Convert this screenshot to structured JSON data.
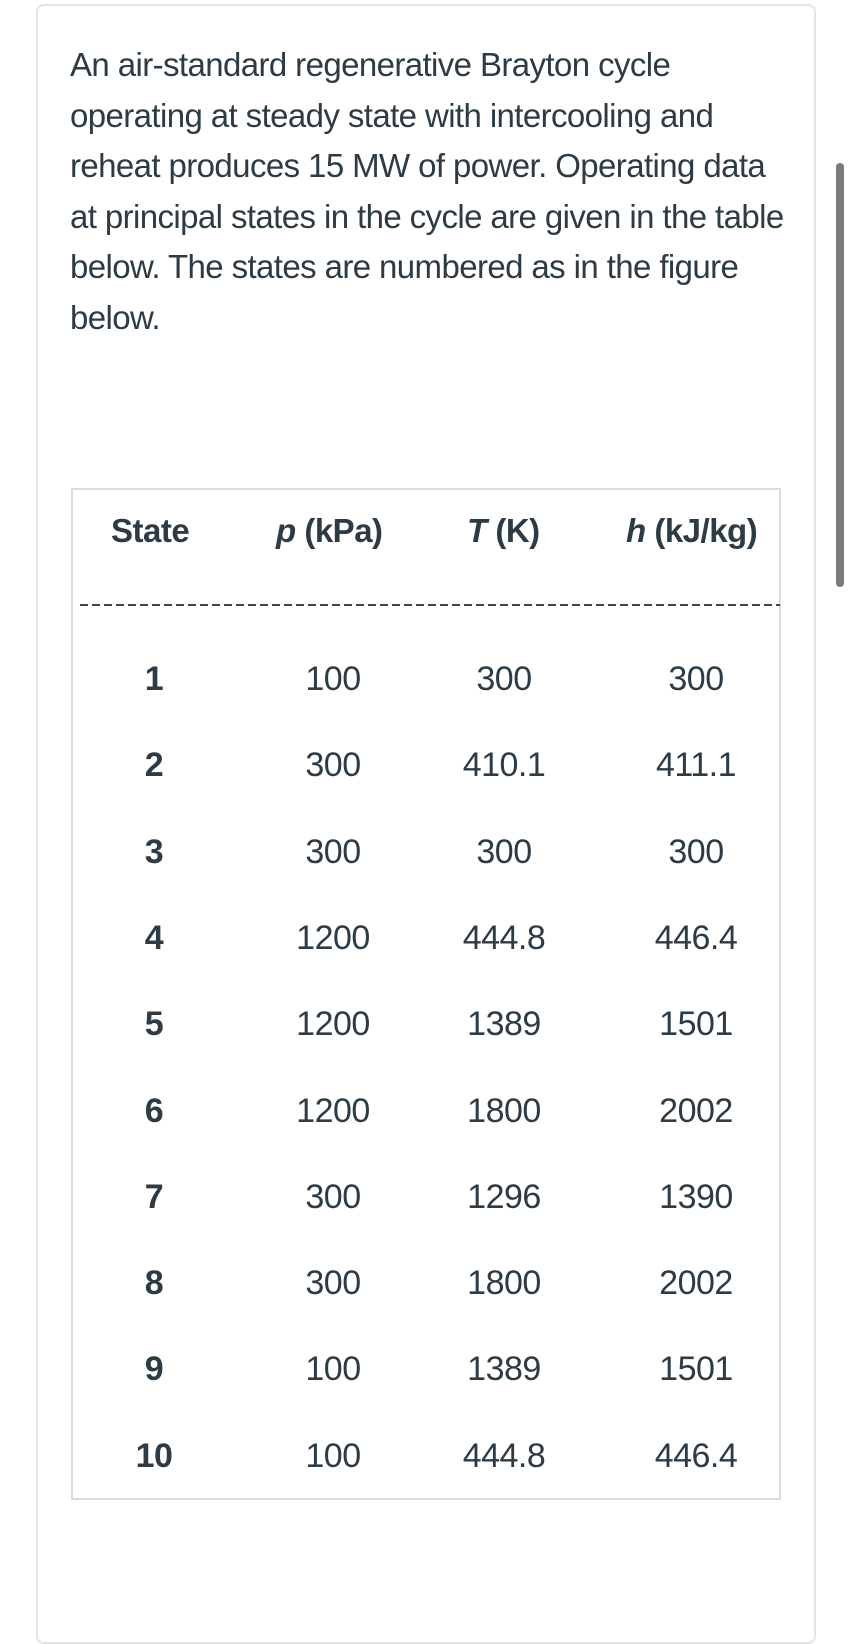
{
  "question": {
    "text": "An air-standard regenerative Brayton cycle operating at steady state with intercooling and reheat produces 15 MW of power. Operating data at principal states in the cycle are given in the table below. The states are numbered as in the figure below."
  },
  "table": {
    "headers": {
      "state": "State",
      "p_sym": "p",
      "p_unit": " (kPa)",
      "T_sym": "T",
      "T_unit": " (K)",
      "h_sym": "h",
      "h_unit": " (kJ/kg)"
    },
    "rows": [
      {
        "state": "1",
        "p": "100",
        "T": "300",
        "h": "300"
      },
      {
        "state": "2",
        "p": "300",
        "T": "410.1",
        "h": "411.1"
      },
      {
        "state": "3",
        "p": "300",
        "T": "300",
        "h": "300"
      },
      {
        "state": "4",
        "p": "1200",
        "T": "444.8",
        "h": "446.4"
      },
      {
        "state": "5",
        "p": "1200",
        "T": "1389",
        "h": "1501"
      },
      {
        "state": "6",
        "p": "1200",
        "T": "1800",
        "h": "2002"
      },
      {
        "state": "7",
        "p": "300",
        "T": "1296",
        "h": "1390"
      },
      {
        "state": "8",
        "p": "300",
        "T": "1800",
        "h": "2002"
      },
      {
        "state": "9",
        "p": "100",
        "T": "1389",
        "h": "1501"
      },
      {
        "state": "10",
        "p": "100",
        "T": "444.8",
        "h": "446.4"
      }
    ]
  }
}
